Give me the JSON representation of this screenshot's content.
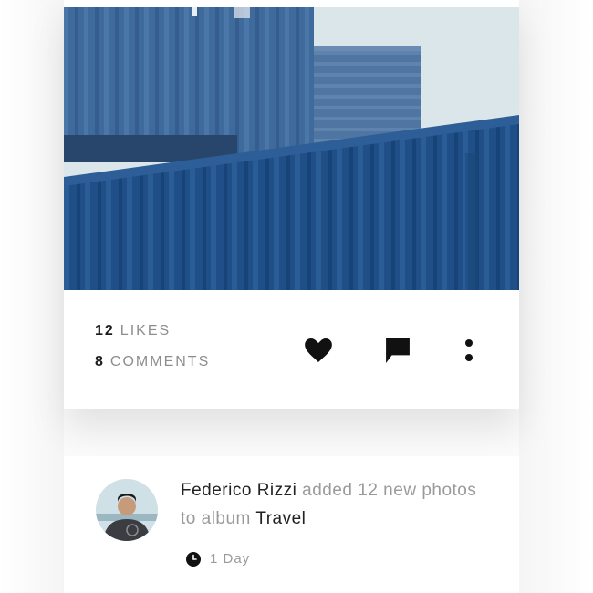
{
  "colors": {
    "accent_text": "#1c1c1c",
    "muted_text": "#8d8d8d",
    "container_blue": "#1d4f86"
  },
  "post": {
    "likes_count": "12",
    "likes_label": "LIKES",
    "comments_count": "8",
    "comments_label": "COMMENTS",
    "icons": [
      "heart-icon",
      "comment-icon",
      "more-vertical-icon"
    ]
  },
  "activity": {
    "user_name": "Federico Rizzi",
    "action_text": " added 12 new photos to album ",
    "album_name": "Travel",
    "time_label": "1 Day",
    "icons": [
      "avatar",
      "clock-icon"
    ]
  }
}
